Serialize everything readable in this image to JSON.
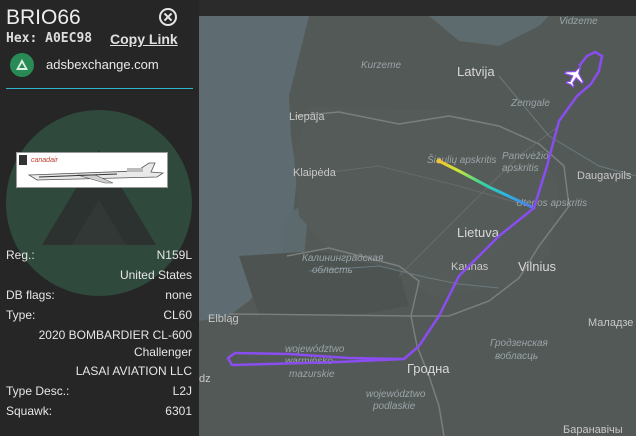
{
  "panel": {
    "callsign": "BRIO66",
    "hex_label": "Hex:",
    "hex_value": "A0EC98",
    "copy_link": "Copy Link",
    "site": "adsbexchange.com",
    "photo_text": "canadair",
    "rows": [
      {
        "label": "Reg.:",
        "value": "N159L"
      },
      {
        "label": "",
        "value": "United States"
      },
      {
        "label": "DB flags:",
        "value": "none"
      },
      {
        "label": "Type:",
        "value": "CL60"
      },
      {
        "label": "",
        "value": "2020 BOMBARDIER CL-600"
      },
      {
        "label": "",
        "value": "Challenger"
      },
      {
        "label": "",
        "value": "LASAI AVIATION LLC"
      },
      {
        "label": "Type Desc.:",
        "value": "L2J"
      },
      {
        "label": "Squawk:",
        "value": "6301"
      }
    ]
  },
  "map": {
    "labels": {
      "vidzeme": "Vidzeme",
      "kurzeme": "Kurzeme",
      "latvija": "Latvija",
      "zemgale": "Zemgale",
      "liepaja": "Liepāja",
      "siauliu": "Šiaulių apskritis",
      "panevezio": "Panevėžio",
      "apskritis": "apskritis",
      "daugavpils": "Daugavpils",
      "klaipeda": "Klaipėda",
      "utenos": "Utenos apskritis",
      "lietuva": "Lietuva",
      "kaliningrad1": "Калининградская",
      "kaliningrad2": "область",
      "kaunas": "Kaunas",
      "vilnius": "Vilnius",
      "malade": "Маладзе",
      "elblag": "Elbląg",
      "hrodna_obl1": "Гродзенская",
      "hrodna_obl2": "вобласць",
      "warminsko1": "województwo",
      "warminsko2": "warmińsko-",
      "warminsko3": "mazurskie",
      "hrodna": "Гродна",
      "podlaskie1": "województwo",
      "podlaskie2": "podlaskie",
      "dz": "dz",
      "baranavichy": "Баранавічы"
    }
  },
  "colors": {
    "track": "#8a4df0",
    "accent": "#2fb5c9",
    "site_icon": "#2a8a55"
  },
  "icons": [
    "close-icon",
    "adsb-logo-icon",
    "aircraft-icon"
  ]
}
